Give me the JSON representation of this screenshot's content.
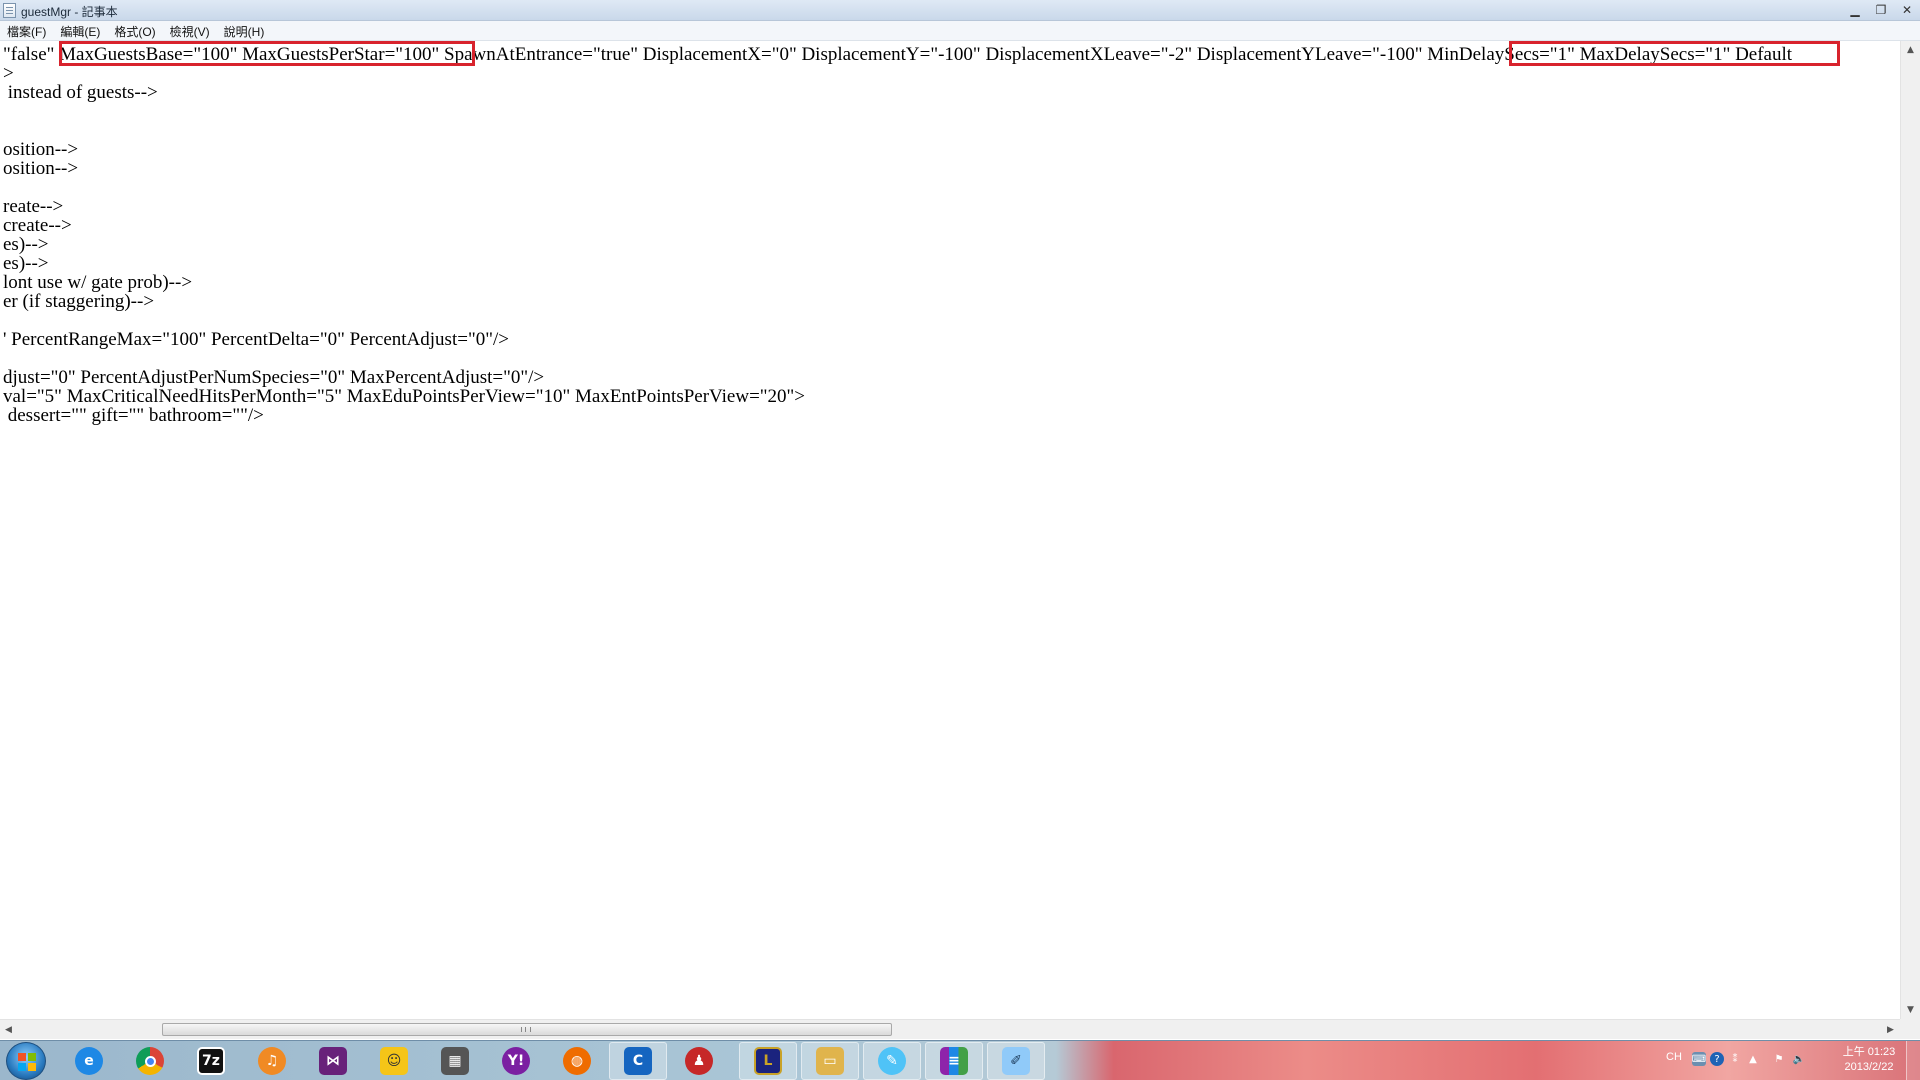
{
  "window": {
    "title": "guestMgr - 記事本"
  },
  "menu": [
    {
      "label": "檔案(F)"
    },
    {
      "label": "編輯(E)"
    },
    {
      "label": "格式(O)"
    },
    {
      "label": "檢視(V)"
    },
    {
      "label": "說明(H)"
    }
  ],
  "editor": {
    "lines": [
      "\"false\" MaxGuestsBase=\"100\" MaxGuestsPerStar=\"100\" SpawnAtEntrance=\"true\" DisplacementX=\"0\" DisplacementY=\"-100\" DisplacementXLeave=\"-2\" DisplacementYLeave=\"-100\" MinDelaySecs=\"1\" MaxDelaySecs=\"1\" Default",
      ">",
      " instead of guests-->",
      "",
      "",
      "osition-->",
      "osition-->",
      "",
      "reate-->",
      "create-->",
      "es)-->",
      "es)-->",
      "lont use w/ gate prob)-->",
      "er (if staggering)-->",
      "",
      "' PercentRangeMax=\"100\" PercentDelta=\"0\" PercentAdjust=\"0\"/>",
      "",
      "djust=\"0\" PercentAdjustPerNumSpecies=\"0\" MaxPercentAdjust=\"0\"/>",
      "val=\"5\" MaxCriticalNeedHitsPerMonth=\"5\" MaxEduPointsPerView=\"10\" MaxEntPointsPerView=\"20\">",
      " dessert=\"\" gift=\"\" bathroom=\"\"/>"
    ],
    "highlight_color": "#d8232d"
  },
  "taskbar": {
    "apps": [
      {
        "icon": "internet-explorer-icon",
        "color": "#1e88e5"
      },
      {
        "icon": "chrome-icon",
        "color": "#db4437"
      },
      {
        "icon": "7zip-icon",
        "color": "#111111",
        "label": "7z"
      },
      {
        "icon": "headphones-icon",
        "color": "#f08a24"
      },
      {
        "icon": "visual-studio-icon",
        "color": "#68217a"
      },
      {
        "icon": "chat-icon",
        "color": "#f5c518"
      },
      {
        "icon": "video-editor-icon",
        "color": "#555555"
      },
      {
        "icon": "yahoo-messenger-icon",
        "color": "#7b1fa2",
        "label": "Y!"
      },
      {
        "icon": "torrent-icon",
        "color": "#ef6c00"
      },
      {
        "icon": "c-app-icon",
        "color": "#1565c0",
        "label": "C"
      },
      {
        "icon": "red-app-icon",
        "color": "#c62828"
      },
      {
        "icon": "league-icon",
        "color": "#1a237e",
        "label": "L"
      },
      {
        "icon": "folder-icon",
        "color": "#e0b44c"
      },
      {
        "icon": "paint-icon",
        "color": "#4fc3f7"
      },
      {
        "icon": "winrar-icon",
        "color": "#8e24aa"
      },
      {
        "icon": "notepad-icon",
        "color": "#90caf9"
      }
    ],
    "tray": {
      "lang": "CH"
    },
    "clock": {
      "time": "上午 01:23",
      "date": "2013/2/22"
    }
  }
}
